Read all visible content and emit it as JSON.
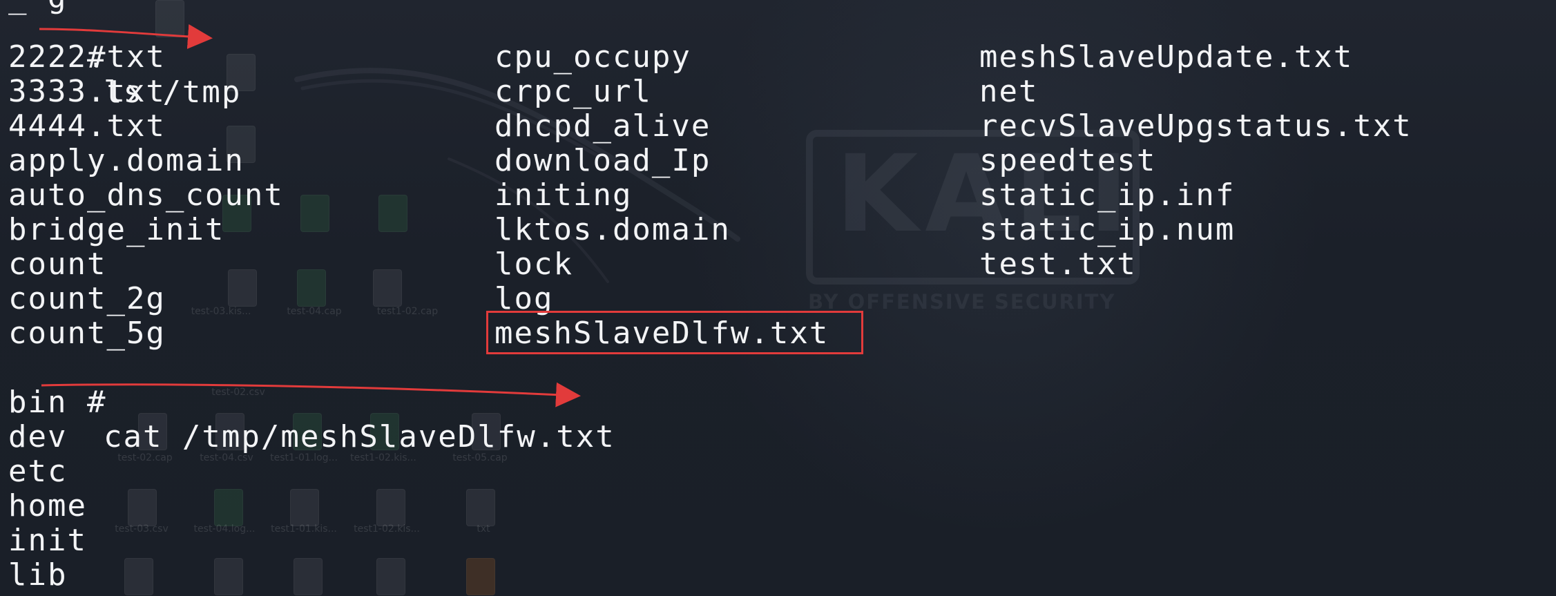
{
  "terminal": {
    "partial_top": "_ g",
    "commands": [
      {
        "prompt": "#",
        "command": "ls /tmp"
      },
      {
        "prompt": "#",
        "command": "cat /tmp/meshSlaveDlfw.txt"
      }
    ],
    "ls_columns": [
      [
        "2222.txt",
        "3333.txt",
        "4444.txt",
        "apply.domain",
        "auto_dns_count",
        "bridge_init",
        "count",
        "count_2g",
        "count_5g"
      ],
      [
        "cpu_occupy",
        "crpc_url",
        "dhcpd_alive",
        "download_Ip",
        "initing",
        "lktos.domain",
        "lock",
        "log",
        "meshSlaveDlfw.txt"
      ],
      [
        "meshSlaveUpdate.txt",
        "net",
        "recvSlaveUpgstatus.txt",
        "speedtest",
        "static_ip.inf",
        "static_ip.num",
        "test.txt"
      ]
    ],
    "cat_output": [
      "bin",
      "dev",
      "etc",
      "home",
      "init",
      "lib"
    ]
  },
  "annotations": {
    "highlighted_file": "meshSlaveDlfw.txt",
    "accent_color": "#e23b3b"
  },
  "background": {
    "watermark_main": "KALI",
    "watermark_sub": "BY OFFENSIVE SECURITY",
    "icon_labels": [
      "test-02.csv",
      "test-03.kis...",
      "test-04.cap",
      "test1-02.cap",
      "test-02.cap",
      "test-04.csv",
      "test1-01.log...",
      "test1-02.kis...",
      "test-05.cap",
      "test-03.csv",
      "test-04.log...",
      "test1-01.kis...",
      "test1-02.kis...",
      "txt"
    ]
  }
}
